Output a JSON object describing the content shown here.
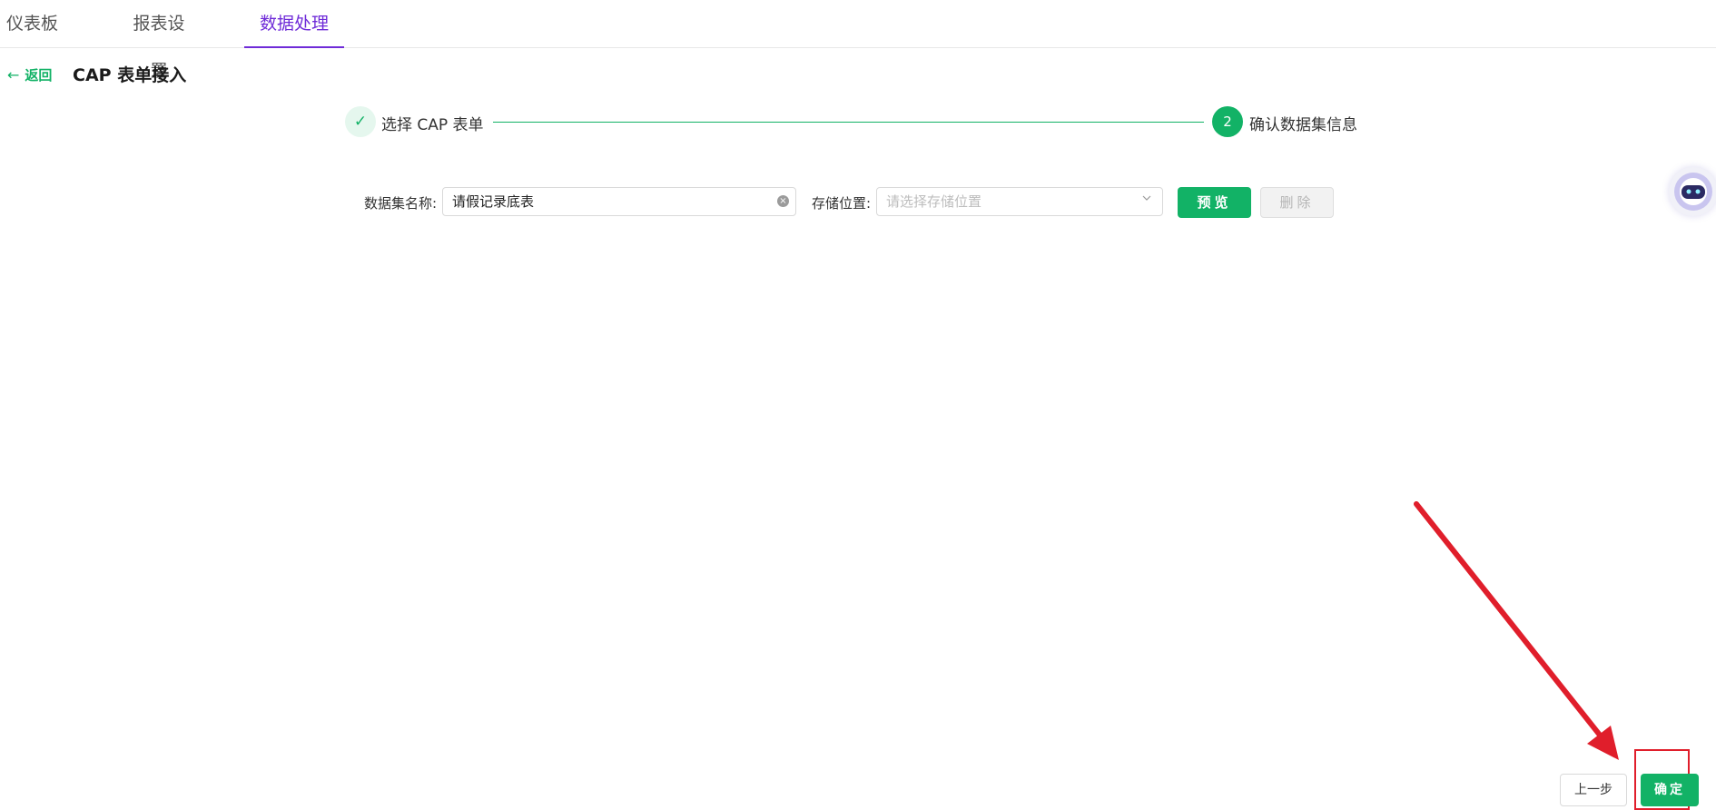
{
  "tabs": [
    {
      "label": "仪表板"
    },
    {
      "label": "报表设置"
    },
    {
      "label": "数据处理"
    }
  ],
  "header": {
    "back_label": "返回",
    "title": "CAP 表单接入"
  },
  "steps": {
    "step1_label": "选择 CAP 表单",
    "step2_number": "2",
    "step2_label": "确认数据集信息"
  },
  "form": {
    "dataset_name_label": "数据集名称:",
    "dataset_name_value": "请假记录底表",
    "storage_label": "存储位置:",
    "storage_placeholder": "请选择存储位置",
    "preview_label": "预览",
    "delete_label": "删除"
  },
  "footer": {
    "prev_label": "上一步",
    "confirm_label": "确定"
  },
  "colors": {
    "accent_green": "#12b266",
    "active_tab_purple": "#6f2bd8",
    "annotation_red": "#e01e2b"
  },
  "icons": {
    "back": "arrow-left-icon",
    "step1": "check-icon",
    "clear": "clear-circle-icon",
    "select": "chevron-down-icon",
    "assistant": "robot-avatar-icon"
  }
}
